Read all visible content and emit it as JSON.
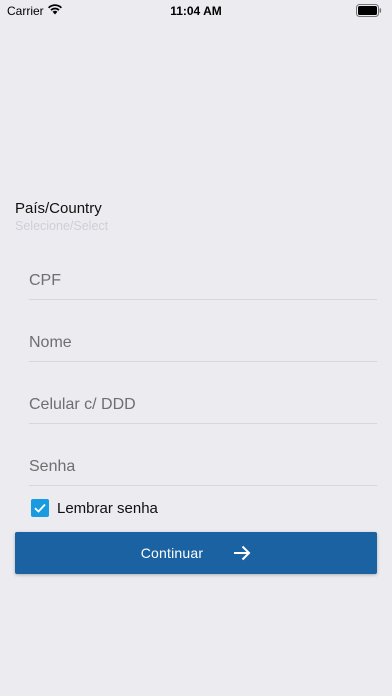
{
  "status_bar": {
    "carrier": "Carrier",
    "time": "11:04 AM"
  },
  "country": {
    "label": "País/Country",
    "select_placeholder": "Selecione/Select"
  },
  "form": {
    "cpf_placeholder": "CPF",
    "name_placeholder": "Nome",
    "phone_placeholder": "Celular c/ DDD",
    "password_placeholder": "Senha",
    "remember_label": "Lembrar senha",
    "remember_checked": true,
    "continue_label": "Continuar"
  },
  "colors": {
    "background": "#ebebf0",
    "primary_button": "#1a62a2",
    "checkbox": "#1a9be0"
  },
  "icons": {
    "wifi": "wifi-icon",
    "battery": "battery-icon",
    "checkmark": "checkmark-icon",
    "arrow": "arrow-right-icon"
  }
}
